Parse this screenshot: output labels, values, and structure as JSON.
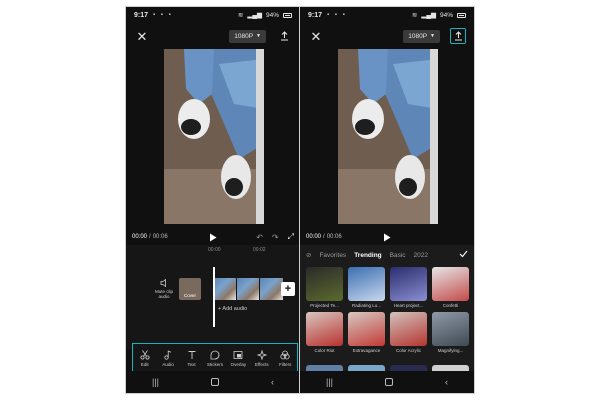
{
  "left_phone": {
    "status": {
      "time": "9:17",
      "battery": "94%"
    },
    "resolution": "1080P",
    "playback": {
      "current": "00:00",
      "separator": "/",
      "total": "00:06"
    },
    "ruler": [
      "00:00",
      "00:02"
    ],
    "timeline": {
      "mute_label": "Mute clip audio",
      "cover_label": "Cover",
      "add_audio": "+ Add audio"
    },
    "toolbar": [
      {
        "label": "Edit",
        "icon": "scissors-icon"
      },
      {
        "label": "Audio",
        "icon": "music-note-icon"
      },
      {
        "label": "Text",
        "icon": "text-icon"
      },
      {
        "label": "Stickers",
        "icon": "sticker-icon"
      },
      {
        "label": "Overlay",
        "icon": "overlay-icon"
      },
      {
        "label": "Effects",
        "icon": "effects-sparkle-icon"
      },
      {
        "label": "Filters",
        "icon": "filters-icon"
      }
    ]
  },
  "right_phone": {
    "status": {
      "time": "9:17",
      "battery": "94%"
    },
    "resolution": "1080P",
    "playback": {
      "current": "00:00",
      "separator": "/",
      "total": "00:06"
    },
    "filter_tabs": [
      {
        "label": "Favorites",
        "active": false
      },
      {
        "label": "Trending",
        "active": true
      },
      {
        "label": "Basic",
        "active": false
      },
      {
        "label": "2022",
        "active": false
      }
    ],
    "effects": [
      {
        "label": "Projected Te...",
        "colors": [
          "#2a2a2a",
          "#5c6b2e"
        ]
      },
      {
        "label": "Radiating Lo...",
        "colors": [
          "#3b6fb0",
          "#c9d8ef"
        ]
      },
      {
        "label": "Heart project...",
        "colors": [
          "#2a2d6e",
          "#8a8fd1"
        ]
      },
      {
        "label": "Confetti",
        "colors": [
          "#e6e6e6",
          "#c44a4a"
        ]
      },
      {
        "label": "Color Riot",
        "colors": [
          "#d9c6bf",
          "#b8322f"
        ]
      },
      {
        "label": "Extravagance",
        "colors": [
          "#d8c9c2",
          "#c23a36"
        ]
      },
      {
        "label": "Color Acrylic",
        "colors": [
          "#d3c2bc",
          "#b53531"
        ]
      },
      {
        "label": "Magnifying...",
        "colors": [
          "#8f9aa6",
          "#3f4a55"
        ]
      }
    ],
    "row3_colors": [
      "#5f7fa3",
      "#7aa6c9",
      "#2b2b4f",
      "#d0d0d0"
    ]
  },
  "colors": {
    "accent": "#16b4c2",
    "background": "#101010"
  }
}
